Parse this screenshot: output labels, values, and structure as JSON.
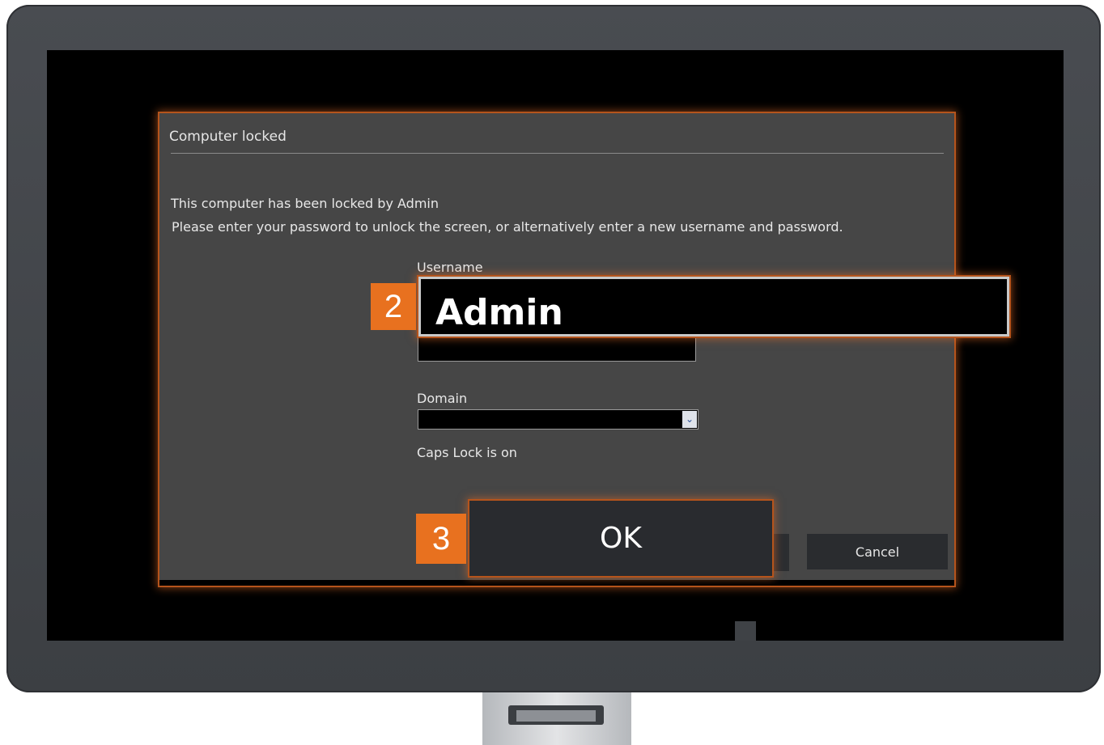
{
  "dialog": {
    "title": "Computer locked",
    "message_line1": "This computer has been locked by Admin",
    "message_line2": "Please enter your password to unlock the screen, or alternatively enter a new username and password.",
    "username_label": "Username",
    "username_value": "Admin",
    "password_value": "",
    "domain_label": "Domain",
    "domain_value": "",
    "caps_lock_message": "Caps Lock is on",
    "ok_label": "OK",
    "cancel_label": "Cancel"
  },
  "callouts": {
    "step_username": "2",
    "step_ok": "3"
  },
  "colors": {
    "highlight_orange": "#e8711f",
    "dialog_bg": "#464646",
    "bezel": "#43464a"
  },
  "icons": {
    "domain_dropdown": "chevron-down-icon"
  }
}
